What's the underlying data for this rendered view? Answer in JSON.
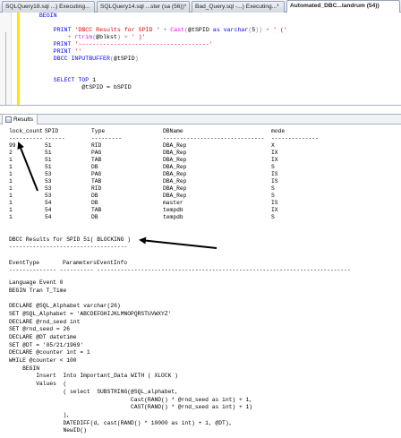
{
  "tabs": [
    {
      "label": "SQLQuery18.sql ...) Executing...",
      "active": false
    },
    {
      "label": "SQLQuery14.sql ...ster (sa (56))*",
      "active": false
    },
    {
      "label": "Bad_Query.sql -...) Executing...*",
      "active": false
    },
    {
      "label": "Automated_DBC...landrum (54))",
      "active": true
    }
  ],
  "editor_lines": [
    {
      "indent": "    ",
      "parts": [
        {
          "t": "BEGIN",
          "k": "kw"
        }
      ]
    },
    {
      "indent": "",
      "parts": []
    },
    {
      "indent": "        ",
      "parts": [
        {
          "t": "PRINT ",
          "k": "kw"
        },
        {
          "t": "'DBCC Results for SPID '",
          "k": "str"
        },
        {
          "t": " + ",
          "k": "op"
        },
        {
          "t": "Cast",
          "k": "fn"
        },
        {
          "t": "(",
          "k": "op"
        },
        {
          "t": "@tSPID ",
          "k": "pl"
        },
        {
          "t": "as varchar",
          "k": "kw"
        },
        {
          "t": "(",
          "k": "op"
        },
        {
          "t": "5",
          "k": "pl"
        },
        {
          "t": ")) + ",
          "k": "op"
        },
        {
          "t": "' ('",
          "k": "str"
        }
      ]
    },
    {
      "indent": "            ",
      "parts": [
        {
          "t": "+ ",
          "k": "op"
        },
        {
          "t": "rtrim",
          "k": "fn"
        },
        {
          "t": "(",
          "k": "op"
        },
        {
          "t": "@blkst",
          "k": "pl"
        },
        {
          "t": ") + ",
          "k": "op"
        },
        {
          "t": "' )'",
          "k": "str"
        }
      ]
    },
    {
      "indent": "        ",
      "parts": [
        {
          "t": "PRINT ",
          "k": "kw"
        },
        {
          "t": "'-------------------------------------'",
          "k": "str"
        }
      ]
    },
    {
      "indent": "        ",
      "parts": [
        {
          "t": "PRINT ",
          "k": "kw"
        },
        {
          "t": "''",
          "k": "str"
        }
      ]
    },
    {
      "indent": "        ",
      "parts": [
        {
          "t": "DBCC INPUTBUFFER",
          "k": "kw"
        },
        {
          "t": "(",
          "k": "op"
        },
        {
          "t": "@tSPID",
          "k": "pl"
        },
        {
          "t": ")",
          "k": "op"
        }
      ]
    },
    {
      "indent": "",
      "parts": []
    },
    {
      "indent": "",
      "parts": []
    },
    {
      "indent": "        ",
      "parts": [
        {
          "t": "SELECT TOP ",
          "k": "kw"
        },
        {
          "t": "1",
          "k": "pl"
        }
      ]
    },
    {
      "indent": "                ",
      "parts": [
        {
          "t": "@tSPID = bSPID",
          "k": "pl"
        }
      ]
    }
  ],
  "results_tab_label": "Results",
  "lock_table": {
    "headers": [
      "lock_count",
      "SPID",
      "Type",
      "DBName",
      "mode"
    ],
    "separator": [
      "----------",
      "------",
      "---------",
      "------------------------------",
      "--------------"
    ],
    "rows": [
      [
        "99",
        "51",
        "RID",
        "DBA_Rep",
        "X"
      ],
      [
        "2",
        "51",
        "PAG",
        "DBA_Rep",
        "IX"
      ],
      [
        "1",
        "51",
        "TAB",
        "DBA_Rep",
        "IX"
      ],
      [
        "1",
        "51",
        "DB",
        "DBA_Rep",
        "S"
      ],
      [
        "1",
        "53",
        "PAG",
        "DBA_Rep",
        "IS"
      ],
      [
        "1",
        "53",
        "TAB",
        "DBA_Rep",
        "IS"
      ],
      [
        "1",
        "53",
        "RID",
        "DBA_Rep",
        "S"
      ],
      [
        "1",
        "53",
        "DB",
        "DBA_Rep",
        "S"
      ],
      [
        "1",
        "54",
        "DB",
        "master",
        "IS"
      ],
      [
        "1",
        "54",
        "TAB",
        "tempdb",
        "IX"
      ],
      [
        "1",
        "54",
        "DB",
        "tempdb",
        "S"
      ]
    ]
  },
  "dbcc_header": "DBCC Results for SPID 51( BLOCKING )",
  "dbcc_rule": "-----------------------------------",
  "event_headers": [
    "EventType",
    "Parameters",
    "EventInfo"
  ],
  "event_separator": "-------------- ---------- ---------------------------------------------------------------------------",
  "event_lines": [
    "Language Event 0",
    "BEGIN Tran T_Time",
    "",
    "DECLARE @SQL_Alphabet varchar(26)",
    "SET @SQL_Alphabet = 'ABCDEFGHIJKLMNOPQRSTUVWXYZ'",
    "DECLARE @rnd_seed int",
    "SET @rnd_seed = 26",
    "DECLARE @DT datetime",
    "SET @DT = '05/21/1969'",
    "DECLARE @counter int = 1",
    "WHILE @counter < 100",
    "    BEGIN",
    "        Insert  Into Important_Data WITH ( XLOCK )",
    "        Values  (",
    "                ( select  SUBSTRING(@SQL_alphabet,",
    "                                    Cast(RAND() * @rnd_seed as int) + 1,",
    "                                    CAST(RAND() * @rnd_seed as int) + 1)",
    "                ),",
    "                DATEDIFF(d, cast(RAND() * 10000 as int) + 1, @DT),",
    "                NewID()"
  ]
}
